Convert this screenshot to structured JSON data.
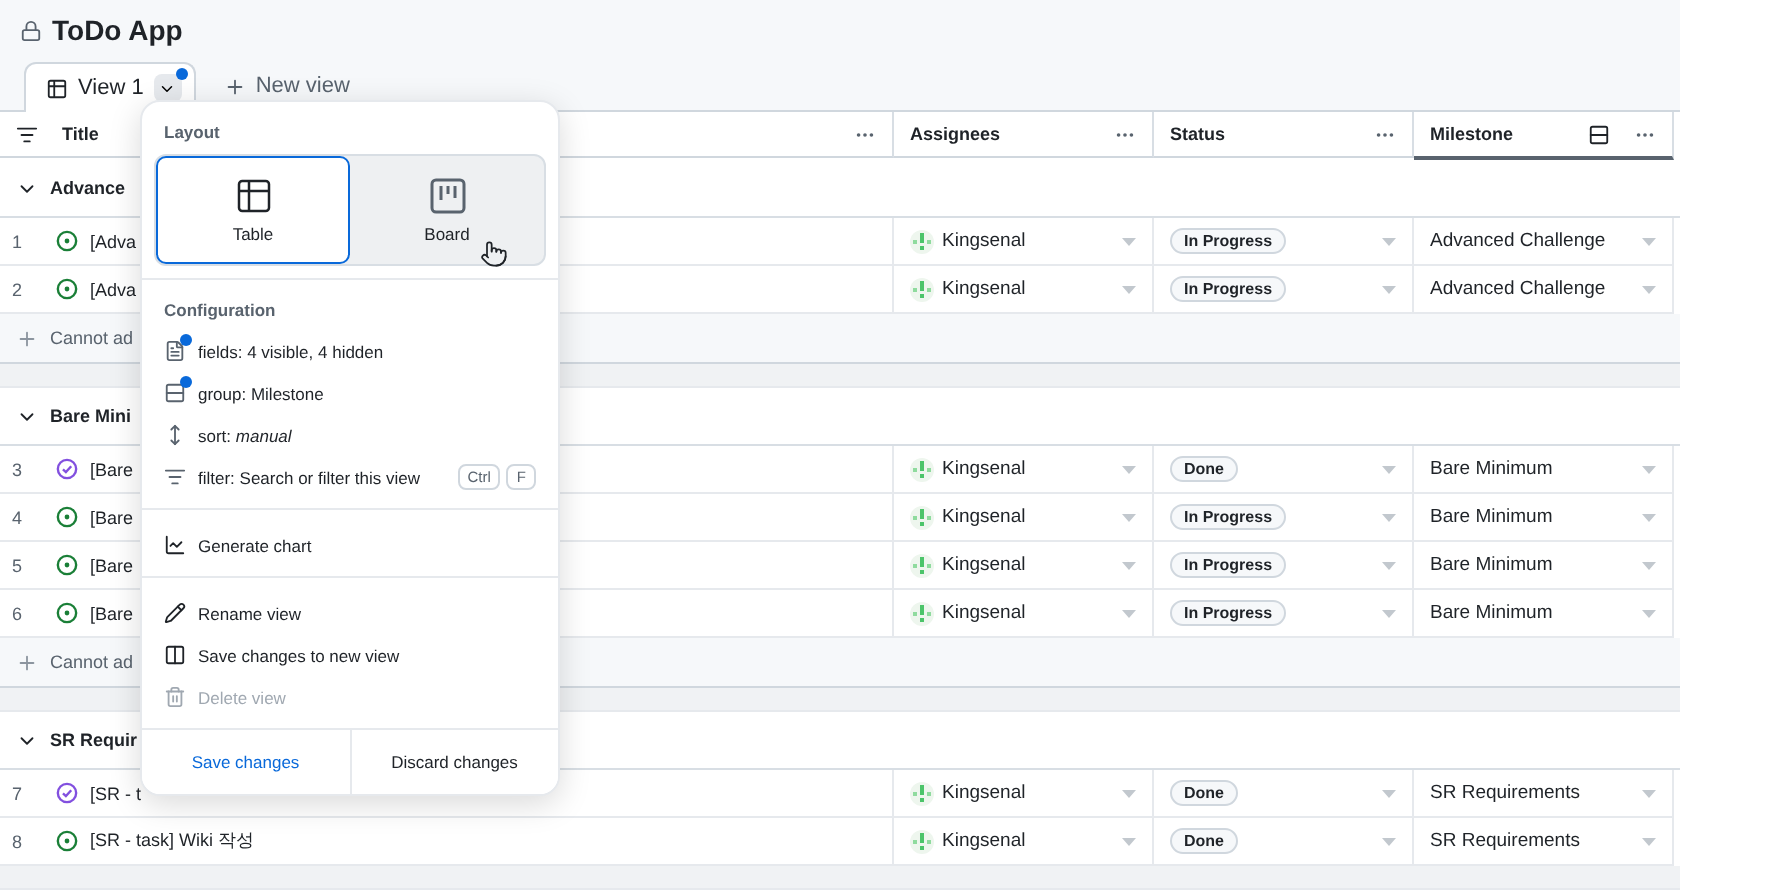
{
  "app": {
    "title": "ToDo App"
  },
  "tabs": [
    {
      "label": "View 1",
      "selected": true,
      "modified": true
    }
  ],
  "new_view": "New view",
  "columns": [
    {
      "label": "Title",
      "grouped": false
    },
    {
      "label": "Assignees",
      "grouped": false
    },
    {
      "label": "Status",
      "grouped": false
    },
    {
      "label": "Milestone",
      "grouped": true
    }
  ],
  "groups": [
    {
      "name": "Advance",
      "expanded": true,
      "add_row": "Cannot ad",
      "rows": [
        {
          "number": "1",
          "title": "[Adva",
          "kind": "open",
          "assignee": "Kingsenal",
          "status": "In Progress",
          "milestone": "Advanced Challenge"
        },
        {
          "number": "2",
          "title": "[Adva",
          "kind": "open",
          "assignee": "Kingsenal",
          "status": "In Progress",
          "milestone": "Advanced Challenge"
        }
      ]
    },
    {
      "name": "Bare Mini",
      "expanded": true,
      "add_row": "Cannot ad",
      "rows": [
        {
          "number": "3",
          "title": "[Bare",
          "kind": "closed",
          "assignee": "Kingsenal",
          "status": "Done",
          "milestone": "Bare Minimum"
        },
        {
          "number": "4",
          "title": "[Bare",
          "kind": "open",
          "assignee": "Kingsenal",
          "status": "In Progress",
          "milestone": "Bare Minimum"
        },
        {
          "number": "5",
          "title": "[Bare",
          "kind": "open",
          "assignee": "Kingsenal",
          "status": "In Progress",
          "milestone": "Bare Minimum"
        },
        {
          "number": "6",
          "title": "[Bare",
          "kind": "open",
          "assignee": "Kingsenal",
          "status": "In Progress",
          "milestone": "Bare Minimum"
        }
      ]
    },
    {
      "name": "SR Requir",
      "expanded": true,
      "rows": [
        {
          "number": "7",
          "title": "[SR - t",
          "kind": "closed",
          "assignee": "Kingsenal",
          "status": "Done",
          "milestone": "SR Requirements"
        },
        {
          "number": "8",
          "title": "[SR - task] Wiki 작성",
          "kind": "open",
          "assignee": "Kingsenal",
          "status": "Done",
          "milestone": "SR Requirements"
        }
      ]
    }
  ],
  "menu": {
    "layout_label": "Layout",
    "layouts": [
      {
        "kind": "table",
        "label": "Table",
        "selected": true
      },
      {
        "kind": "board",
        "label": "Board",
        "selected": false
      }
    ],
    "configuration_label": "Configuration",
    "config_items": [
      {
        "kind": "fields",
        "text": "fields: 4 visible, 4 hidden",
        "modified": true
      },
      {
        "kind": "group",
        "text": "group: Milestone",
        "modified": true
      },
      {
        "kind": "sort",
        "text": "sort: *manual*",
        "modified": false
      },
      {
        "kind": "filter",
        "text": "filter: Search or filter this view",
        "modified": false,
        "keys": [
          "Ctrl",
          "F"
        ]
      }
    ],
    "action_sections": [
      [
        {
          "kind": "chart",
          "label": "Generate chart",
          "disabled": false
        }
      ],
      [
        {
          "kind": "rename",
          "label": "Rename view",
          "disabled": false
        },
        {
          "kind": "duplicate",
          "label": "Save changes to new view",
          "disabled": false
        },
        {
          "kind": "delete",
          "label": "Delete view",
          "disabled": true
        }
      ]
    ],
    "save": "Save changes",
    "discard": "Discard changes"
  }
}
